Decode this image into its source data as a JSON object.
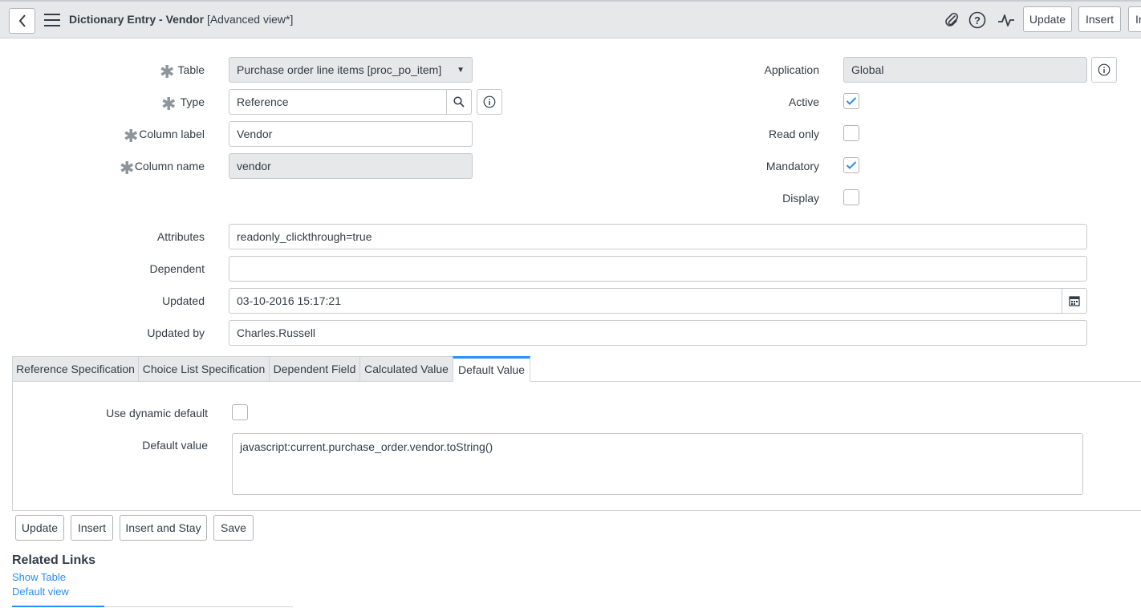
{
  "header": {
    "title": "Dictionary Entry - Vendor",
    "subtitle": "[Advanced view*]",
    "buttons": {
      "update": "Update",
      "insert": "Insert",
      "insert_cut": "In"
    },
    "icons": [
      "back-icon",
      "menu-icon",
      "attachment-icon",
      "help-icon",
      "activity-icon"
    ]
  },
  "form": {
    "table": {
      "label": "Table",
      "value": "Purchase order line items [proc_po_item]"
    },
    "type": {
      "label": "Type",
      "value": "Reference"
    },
    "column_label": {
      "label": "Column label",
      "value": "Vendor"
    },
    "column_name": {
      "label": "Column name",
      "value": "vendor"
    },
    "application": {
      "label": "Application",
      "value": "Global"
    },
    "active": {
      "label": "Active",
      "checked": true
    },
    "read_only": {
      "label": "Read only",
      "checked": false
    },
    "mandatory": {
      "label": "Mandatory",
      "checked": true
    },
    "display": {
      "label": "Display",
      "checked": false
    },
    "attributes": {
      "label": "Attributes",
      "value": "readonly_clickthrough=true"
    },
    "dependent": {
      "label": "Dependent",
      "value": ""
    },
    "updated": {
      "label": "Updated",
      "value": "03-10-2016 15:17:21"
    },
    "updated_by": {
      "label": "Updated by",
      "value": "Charles.Russell"
    }
  },
  "tabs": [
    {
      "label": "Reference Specification",
      "active": false
    },
    {
      "label": "Choice List Specification",
      "active": false
    },
    {
      "label": "Dependent Field",
      "active": false
    },
    {
      "label": "Calculated Value",
      "active": false
    },
    {
      "label": "Default Value",
      "active": true
    }
  ],
  "default_tab": {
    "use_dynamic_default": {
      "label": "Use dynamic default",
      "checked": false
    },
    "default_value": {
      "label": "Default value",
      "value": "javascript:current.purchase_order.vendor.toString()"
    }
  },
  "footer_buttons": {
    "update": "Update",
    "insert": "Insert",
    "insert_and_stay": "Insert and Stay",
    "save": "Save"
  },
  "related_links": {
    "title": "Related Links",
    "links": [
      "Show Table",
      "Default view"
    ]
  },
  "colors": {
    "accent": "#278efc",
    "header_bg": "#e6e8ea",
    "readonly_bg": "#e6e8ea"
  }
}
